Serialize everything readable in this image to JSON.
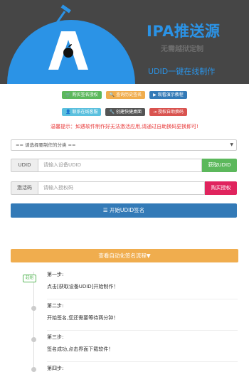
{
  "banner": {
    "title": "IPA推送源",
    "subtitle": "无需越狱定制",
    "tagline": "UDID一键在线制作",
    "logo_letter": "A"
  },
  "top_buttons": [
    {
      "label": "购买签名授权",
      "icon": "cart-icon"
    },
    {
      "label": "查询历史签名",
      "icon": "search-icon"
    },
    {
      "label": "观看演示教程",
      "icon": "video-icon"
    }
  ],
  "mid_buttons": [
    {
      "label": "联系在线客服",
      "icon": "user-icon"
    },
    {
      "label": "创建快捷桌面",
      "icon": "wrench-icon"
    },
    {
      "label": "授权自助换码",
      "icon": "login-icon"
    }
  ],
  "notice": "温馨提示：如遇软件制作好无法激活应用,请通过自助换码更换即可!",
  "category_select": {
    "value": "== 请选择要制作的分类 =="
  },
  "udid": {
    "label": "UDID",
    "placeholder": "请输入设备UDID",
    "action": "获取UDID"
  },
  "code": {
    "label": "激活码",
    "placeholder": "请输入授权码",
    "action": "购买授权"
  },
  "start_button": "开始UDID签名",
  "flow_button": "查看自动化签名流程▼",
  "timeline": {
    "badge": "起始",
    "steps": [
      {
        "title": "第一步:",
        "desc": "点击[获取设备UDID]开始制作！"
      },
      {
        "title": "第二步:",
        "desc": "开始签名,您还需要等待两分钟！"
      },
      {
        "title": "第三步:",
        "desc": "签名成功,点击界面下载软件！"
      },
      {
        "title": "第四步:",
        "desc": ""
      }
    ]
  },
  "colors": {
    "brand_blue": "#2b93e6",
    "success": "#5cb85c",
    "warning": "#f0ad4e",
    "primary": "#337ab7",
    "info": "#5bc0de",
    "danger": "#d9534f",
    "dark": "#555555",
    "notice_red": "#e83a3a"
  }
}
